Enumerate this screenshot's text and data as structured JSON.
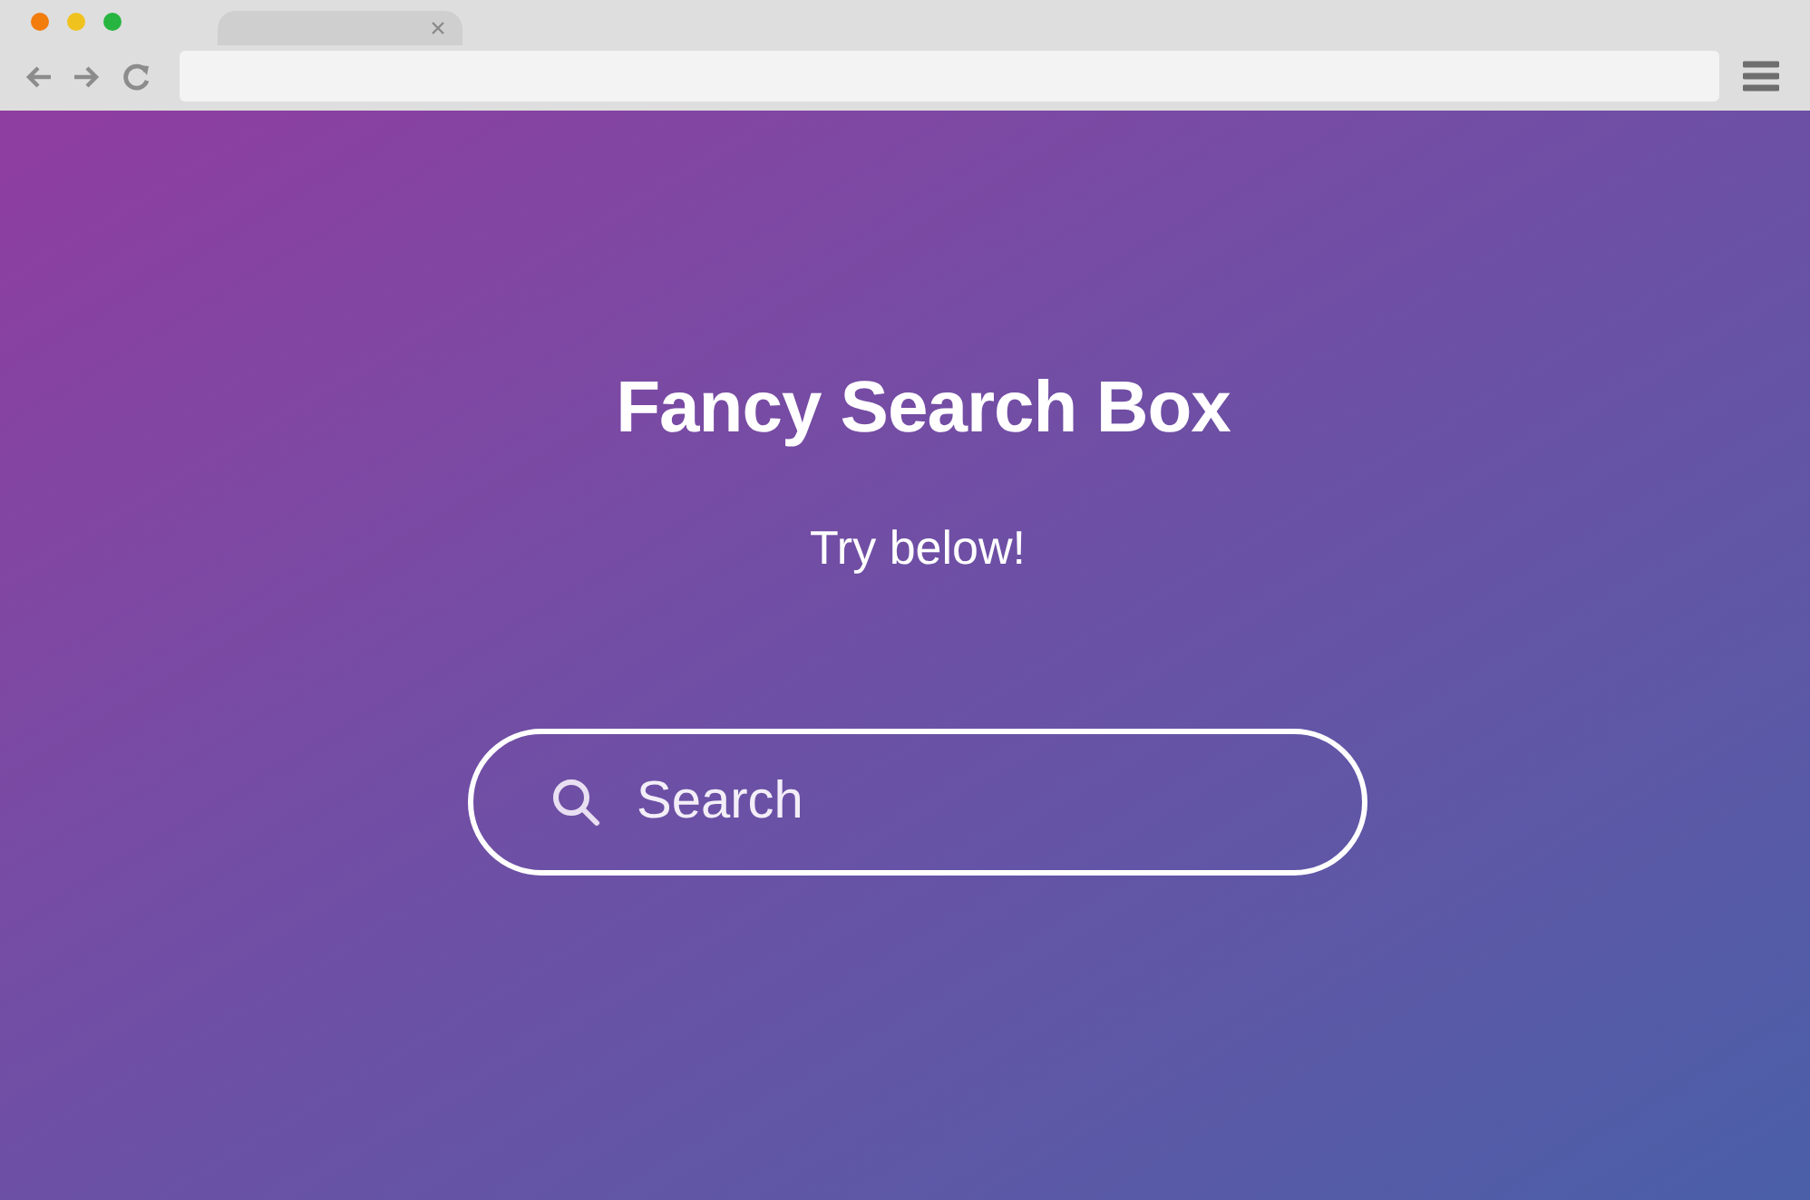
{
  "page": {
    "title": "Fancy Search Box",
    "subtitle": "Try below!",
    "search": {
      "placeholder": "Search"
    }
  }
}
